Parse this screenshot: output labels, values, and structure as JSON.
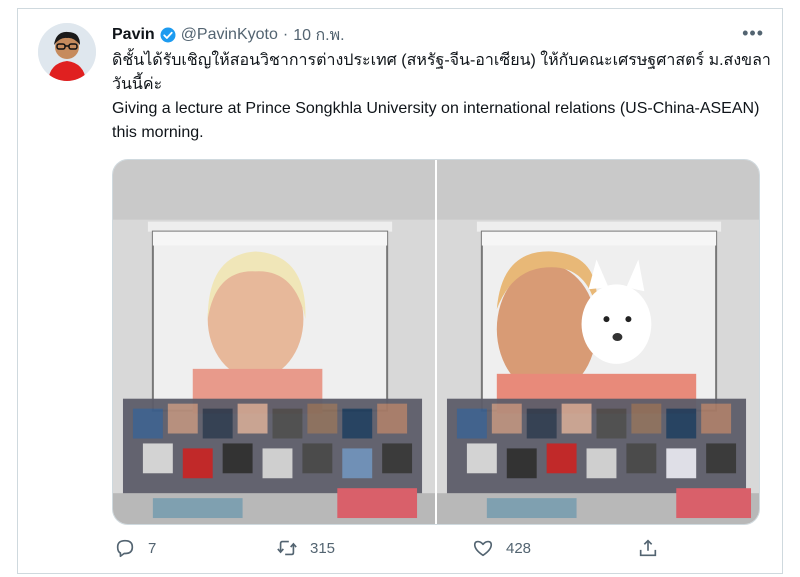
{
  "tweet": {
    "author_name": "Pavin",
    "handle": "@PavinKyoto",
    "separator": "·",
    "date": "10 ก.พ.",
    "text_thai": "ดิชั้นได้รับเชิญให้สอนวิชาการต่างประเทศ (สหรัฐ-จีน-อาเซียน) ให้กับคณะเศรษฐศาสตร์ ม.สงขลา วันนี้ค่ะ",
    "text_english": "Giving a lecture at Prince Songkhla University on international relations (US-China-ASEAN) this morning.",
    "more_label": "•••"
  },
  "stats": {
    "replies": "7",
    "retweets": "315",
    "likes": "428"
  },
  "colors": {
    "verified": "#1d9bf0",
    "muted_text": "#536471",
    "border": "#cfd9de"
  },
  "icons": {
    "verified": "verified-badge-icon",
    "more": "more-options-icon",
    "reply": "reply-icon",
    "retweet": "retweet-icon",
    "like": "like-icon",
    "share": "share-icon"
  }
}
